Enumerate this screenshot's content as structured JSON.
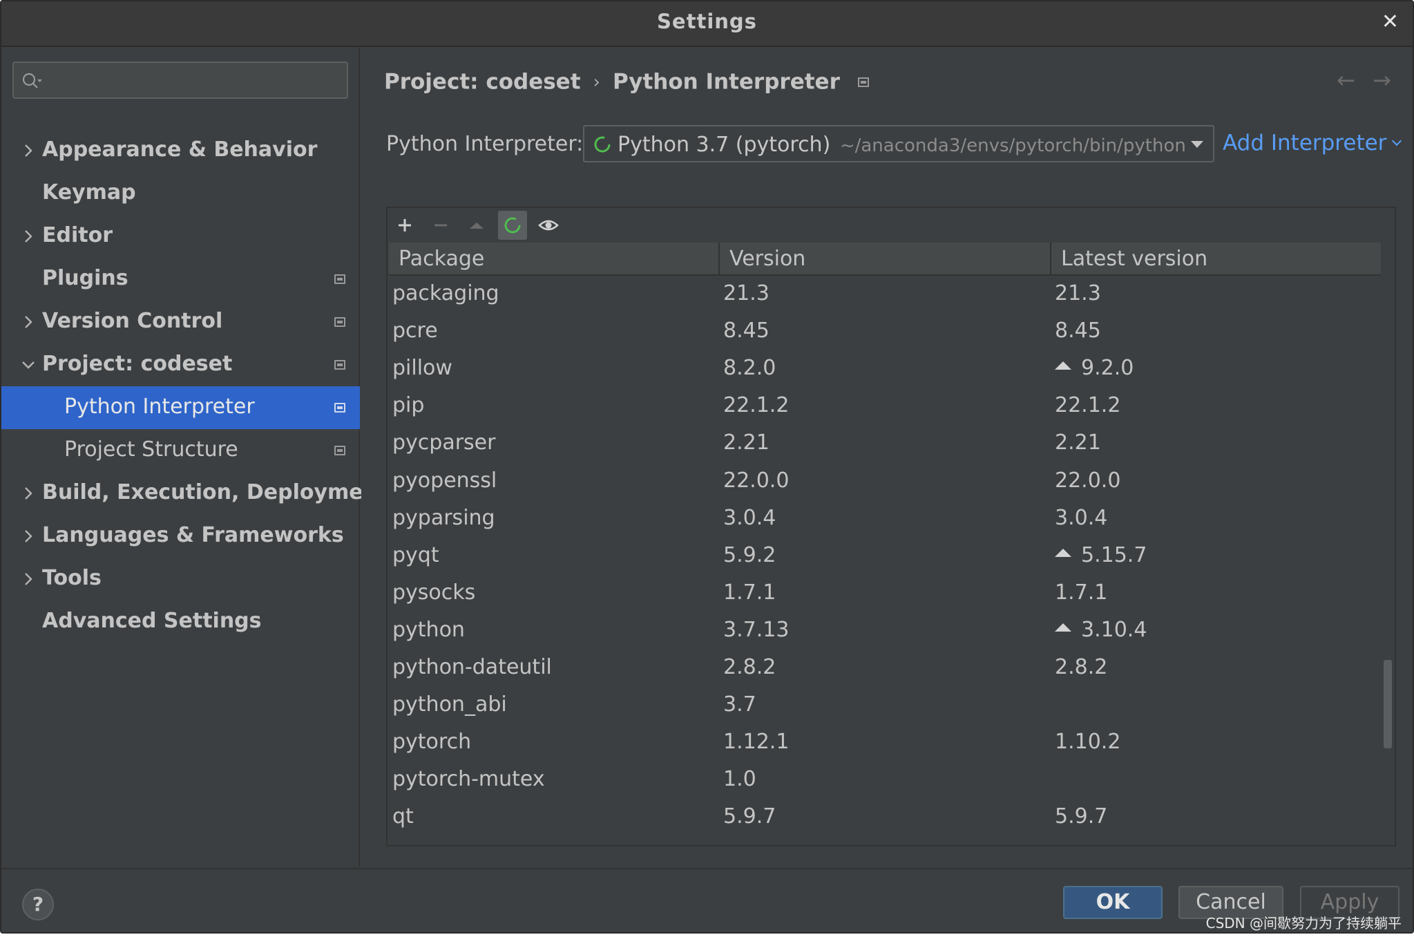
{
  "window": {
    "title": "Settings"
  },
  "search": {
    "placeholder": "",
    "value": ""
  },
  "sidebar": {
    "items": [
      {
        "label": "Appearance & Behavior",
        "expandable": true,
        "expanded": false,
        "modified": false
      },
      {
        "label": "Keymap",
        "expandable": false,
        "modified": false
      },
      {
        "label": "Editor",
        "expandable": true,
        "expanded": false,
        "modified": false
      },
      {
        "label": "Plugins",
        "expandable": false,
        "modified": true
      },
      {
        "label": "Version Control",
        "expandable": true,
        "expanded": false,
        "modified": true
      },
      {
        "label": "Project: codeset",
        "expandable": true,
        "expanded": true,
        "modified": true
      },
      {
        "label": "Python Interpreter",
        "child": true,
        "selected": true,
        "modified": true
      },
      {
        "label": "Project Structure",
        "child": true,
        "modified": true
      },
      {
        "label": "Build, Execution, Deployment",
        "expandable": true,
        "expanded": false,
        "modified": false
      },
      {
        "label": "Languages & Frameworks",
        "expandable": true,
        "expanded": false,
        "modified": false
      },
      {
        "label": "Tools",
        "expandable": true,
        "expanded": false,
        "modified": false
      },
      {
        "label": "Advanced Settings",
        "expandable": false,
        "modified": false
      }
    ]
  },
  "breadcrumb": {
    "project": "Project: codeset",
    "separator": "›",
    "page": "Python Interpreter"
  },
  "interpreter": {
    "label": "Python Interpreter:",
    "selected_name": "Python 3.7 (pytorch)",
    "selected_path": "~/anaconda3/envs/pytorch/bin/python",
    "add_label": "Add Interpreter"
  },
  "toolbar": {
    "icons": [
      "plus-icon",
      "minus-icon",
      "upgrade-icon",
      "refresh-icon",
      "eye-icon"
    ]
  },
  "table": {
    "headers": [
      "Package",
      "Version",
      "Latest version"
    ],
    "rows": [
      {
        "package": "packaging",
        "version": "21.3",
        "latest": "21.3",
        "upgrade": false
      },
      {
        "package": "pcre",
        "version": "8.45",
        "latest": "8.45",
        "upgrade": false
      },
      {
        "package": "pillow",
        "version": "8.2.0",
        "latest": "9.2.0",
        "upgrade": true
      },
      {
        "package": "pip",
        "version": "22.1.2",
        "latest": "22.1.2",
        "upgrade": false
      },
      {
        "package": "pycparser",
        "version": "2.21",
        "latest": "2.21",
        "upgrade": false
      },
      {
        "package": "pyopenssl",
        "version": "22.0.0",
        "latest": "22.0.0",
        "upgrade": false
      },
      {
        "package": "pyparsing",
        "version": "3.0.4",
        "latest": "3.0.4",
        "upgrade": false
      },
      {
        "package": "pyqt",
        "version": "5.9.2",
        "latest": "5.15.7",
        "upgrade": true
      },
      {
        "package": "pysocks",
        "version": "1.7.1",
        "latest": "1.7.1",
        "upgrade": false
      },
      {
        "package": "python",
        "version": "3.7.13",
        "latest": "3.10.4",
        "upgrade": true
      },
      {
        "package": "python-dateutil",
        "version": "2.8.2",
        "latest": "2.8.2",
        "upgrade": false
      },
      {
        "package": "python_abi",
        "version": "3.7",
        "latest": "",
        "upgrade": false
      },
      {
        "package": "pytorch",
        "version": "1.12.1",
        "latest": "1.10.2",
        "upgrade": false
      },
      {
        "package": "pytorch-mutex",
        "version": "1.0",
        "latest": "",
        "upgrade": false
      },
      {
        "package": "qt",
        "version": "5.9.7",
        "latest": "5.9.7",
        "upgrade": false
      }
    ]
  },
  "footer": {
    "help_label": "?",
    "ok_label": "OK",
    "cancel_label": "Cancel",
    "apply_label": "Apply"
  },
  "watermark": "CSDN @间歇努力为了持续躺平",
  "colors": {
    "background": "#3c3f41",
    "selection": "#2f65ca",
    "link": "#589df6",
    "spinner": "#4fbd4f",
    "ok_button": "#365880"
  }
}
